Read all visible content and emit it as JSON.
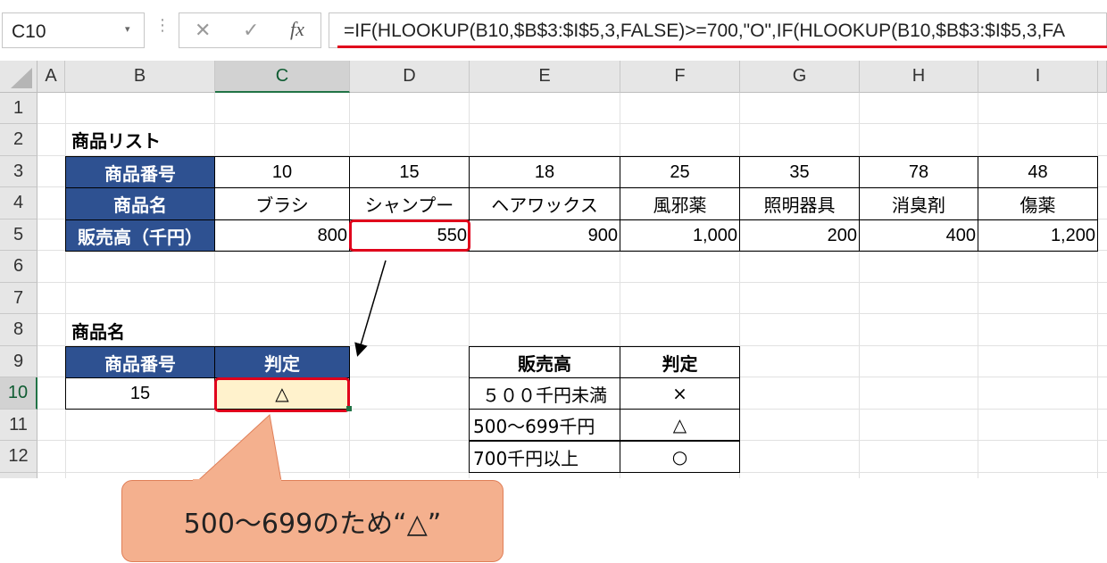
{
  "formula_bar": {
    "name_box": "C10",
    "cancel_icon": "close-icon",
    "enter_icon": "check-icon",
    "fx_label": "fx",
    "formula": "=IF(HLOOKUP(B10,$B$3:$I$5,3,FALSE)>=700,\"O\",IF(HLOOKUP(B10,$B$3:$I$5,3,FA"
  },
  "columns": [
    "A",
    "B",
    "C",
    "D",
    "E",
    "F",
    "G",
    "H",
    "I"
  ],
  "rows": [
    "1",
    "2",
    "3",
    "4",
    "5",
    "6",
    "7",
    "8",
    "9",
    "10",
    "11",
    "12"
  ],
  "product_list": {
    "title": "商品リスト",
    "labels": [
      "商品番号",
      "商品名",
      "販売高（千円）"
    ],
    "numbers": [
      "10",
      "15",
      "18",
      "25",
      "35",
      "78",
      "48"
    ],
    "names": [
      "ブラシ",
      "シャンプー",
      "ヘアワックス",
      "風邪薬",
      "照明器具",
      "消臭剤",
      "傷薬"
    ],
    "sales": [
      "800",
      "550",
      "900",
      "1,000",
      "200",
      "400",
      "1,200"
    ]
  },
  "lookup": {
    "title": "商品名",
    "header_number": "商品番号",
    "header_judge": "判定",
    "number": "15",
    "judge": "△"
  },
  "criteria": {
    "header_sales": "販売高",
    "header_judge": "判定",
    "rows": [
      {
        "range": "５００千円未満",
        "mark": "×"
      },
      {
        "range": "500～699千円",
        "mark": "△"
      },
      {
        "range": "700千円以上",
        "mark": "○"
      }
    ]
  },
  "callout": "500～699のため“△”",
  "colors": {
    "header_fill": "#2e5191",
    "highlight": "#e0001b",
    "selected_fill": "#fff2cc",
    "callout_fill": "#f4b08e"
  }
}
